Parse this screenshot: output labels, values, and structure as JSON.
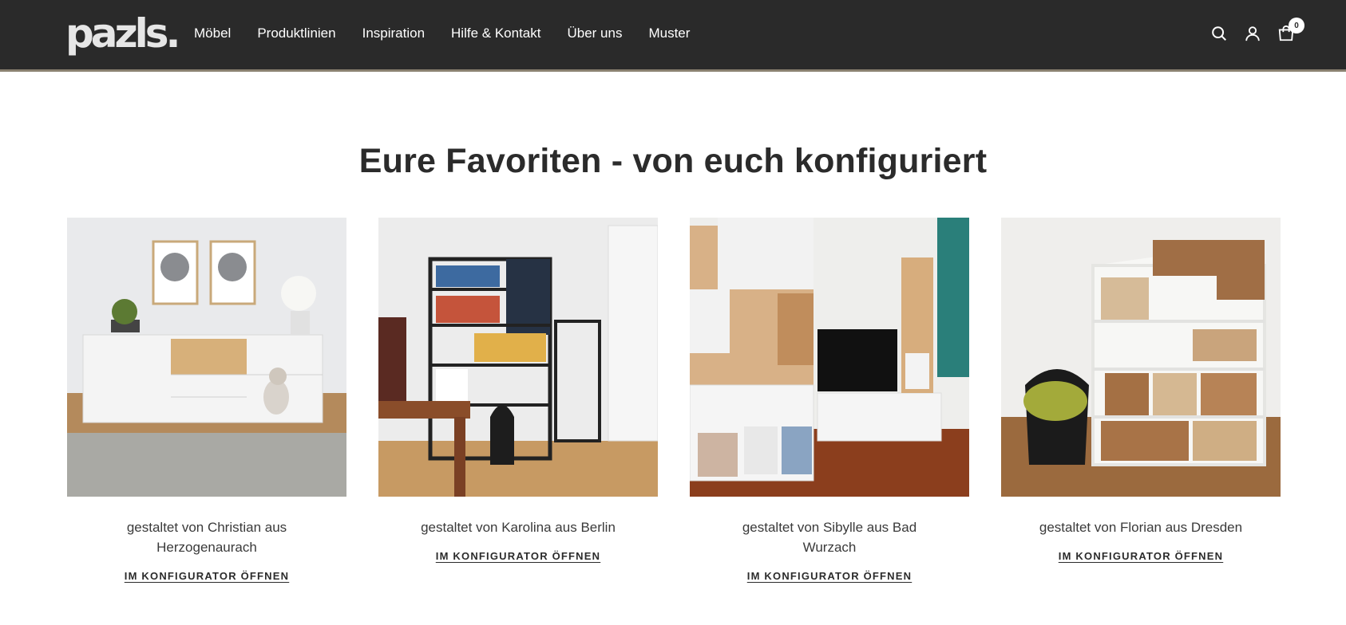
{
  "header": {
    "logo": "pazls.",
    "nav": [
      "Möbel",
      "Produktlinien",
      "Inspiration",
      "Hilfe & Kontakt",
      "Über uns",
      "Muster"
    ],
    "cart_count": "0",
    "icons": [
      "search-icon",
      "account-icon",
      "cart-icon"
    ]
  },
  "section": {
    "title": "Eure Favoriten - von euch konfiguriert",
    "cards": [
      {
        "caption": "gestaltet von Christian aus Herzogenaurach",
        "link": "IM KONFIGURATOR ÖFFNEN"
      },
      {
        "caption": "gestaltet von Karolina aus Berlin",
        "link": "IM KONFIGURATOR ÖFFNEN"
      },
      {
        "caption": "gestaltet von Sibylle aus Bad Wurzach",
        "link": "IM KONFIGURATOR ÖFFNEN"
      },
      {
        "caption": "gestaltet von Florian aus Dresden",
        "link": "IM KONFIGURATOR ÖFFNEN"
      }
    ]
  },
  "colors": {
    "header_bg": "#2a2a2a",
    "header_accent": "#8a8170",
    "text": "#2b2b2b"
  }
}
